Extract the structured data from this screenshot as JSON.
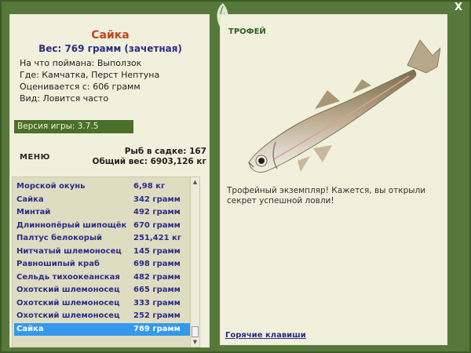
{
  "window": {
    "close_label": "X"
  },
  "fish": {
    "name": "Сайка",
    "weight_line": "Вес: 769 грамм (зачетная)",
    "info": [
      "На что поймана: Выползок",
      "Где: Камчатка, Перст Нептуна",
      "Оценивается с: 606 грамм",
      "Вид: Ловится часто"
    ]
  },
  "version": "Версия игры: 3.7.5",
  "menu_label": "МЕНЮ",
  "stats": {
    "count_line": "Рыб в садке: 167",
    "total_line": "Общий вес: 6903,126 кг"
  },
  "catch_list": [
    {
      "name": "Морской окунь",
      "weight": "6,98 кг"
    },
    {
      "name": "Сайка",
      "weight": "342 грамм"
    },
    {
      "name": "Минтай",
      "weight": "492 грамм"
    },
    {
      "name": "Длиннопёрый шипощёк",
      "weight": "670 грамм"
    },
    {
      "name": "Палтус белокорый",
      "weight": "251,421 кг"
    },
    {
      "name": "Нитчатый шлемоносец",
      "weight": "145 грамм"
    },
    {
      "name": "Равношипый краб",
      "weight": "698 грамм"
    },
    {
      "name": "Сельдь тихоокеанская",
      "weight": "482 грамм"
    },
    {
      "name": "Охотский шлемоносец",
      "weight": "665 грамм"
    },
    {
      "name": "Охотский шлемоносец",
      "weight": "333 грамм"
    },
    {
      "name": "Охотский шлемоносец",
      "weight": "252 грамм"
    },
    {
      "name": "Сайка",
      "weight": "769 грамм"
    }
  ],
  "selected_index": 11,
  "trophy": {
    "title": "ТРОФЕЙ",
    "message": "Трофейный экземпляр! Кажется, вы открыли секрет успешной ловли!",
    "hotkeys_label": "Горячие клавиши"
  },
  "colors": {
    "frame": "#56783a",
    "panel": "#f1f0dc",
    "fish_name": "#c0451c",
    "list_text": "#2a2d86",
    "selection": "#3399ee"
  }
}
